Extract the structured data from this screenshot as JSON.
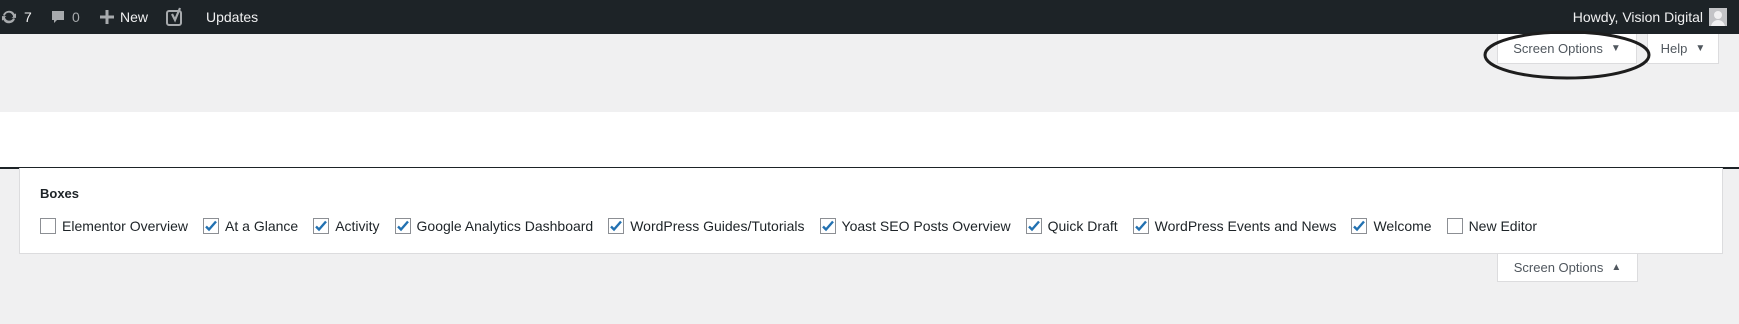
{
  "adminbar": {
    "updates_count": "7",
    "comments_count": "0",
    "new_label": "New",
    "updates_label": "Updates",
    "howdy_text": "Howdy, Vision Digital",
    "icons": [
      "refresh-icon",
      "comment-bubble-icon",
      "plus-icon",
      "yoast-logo-icon",
      "avatar"
    ]
  },
  "tabs": {
    "screen_options_label": "Screen Options",
    "help_label": "Help",
    "screen_options_bottom_label": "Screen Options"
  },
  "panel": {
    "heading": "Boxes",
    "options": [
      {
        "label": "Elementor Overview",
        "checked": false
      },
      {
        "label": "At a Glance",
        "checked": true
      },
      {
        "label": "Activity",
        "checked": true
      },
      {
        "label": "Google Analytics Dashboard",
        "checked": true
      },
      {
        "label": "WordPress Guides/Tutorials",
        "checked": true
      },
      {
        "label": "Yoast SEO Posts Overview",
        "checked": true
      },
      {
        "label": "Quick Draft",
        "checked": true
      },
      {
        "label": "WordPress Events and News",
        "checked": true
      },
      {
        "label": "Welcome",
        "checked": true
      },
      {
        "label": "New Editor",
        "checked": false
      }
    ]
  },
  "colors": {
    "adminbar_bg": "#1d2327",
    "page_bg": "#f0f0f1",
    "checkbox_check": "#2271b1",
    "annotation_ellipse": "#1d1d1d"
  }
}
